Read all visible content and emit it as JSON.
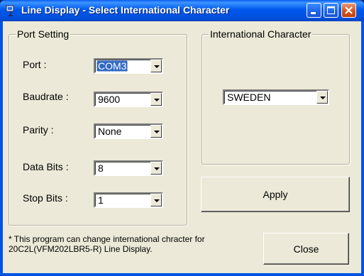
{
  "window": {
    "title": "Line Display - Select International Character"
  },
  "port_setting": {
    "group_label": "Port Setting",
    "port": {
      "label": "Port :",
      "value": "COM3"
    },
    "baudrate": {
      "label": "Baudrate :",
      "value": "9600"
    },
    "parity": {
      "label": "Parity :",
      "value": "None"
    },
    "data_bits": {
      "label": "Data Bits :",
      "value": "8"
    },
    "stop_bits": {
      "label": "Stop Bits :",
      "value": "1"
    }
  },
  "intl": {
    "group_label": "International Character",
    "value": "SWEDEN"
  },
  "buttons": {
    "apply": "Apply",
    "close": "Close"
  },
  "note": {
    "line1": "* This program can change international chracter for",
    "line2": "20C2L(VFM202LBR5-R) Line Display."
  },
  "colors": {
    "titlebar": "#0058ee",
    "face": "#ece9d8",
    "selection": "#316ac5",
    "close_btn": "#d2541f"
  },
  "icons": {
    "app": "app-icon",
    "minimize": "minimize-icon",
    "maximize": "maximize-icon",
    "close": "close-icon"
  }
}
